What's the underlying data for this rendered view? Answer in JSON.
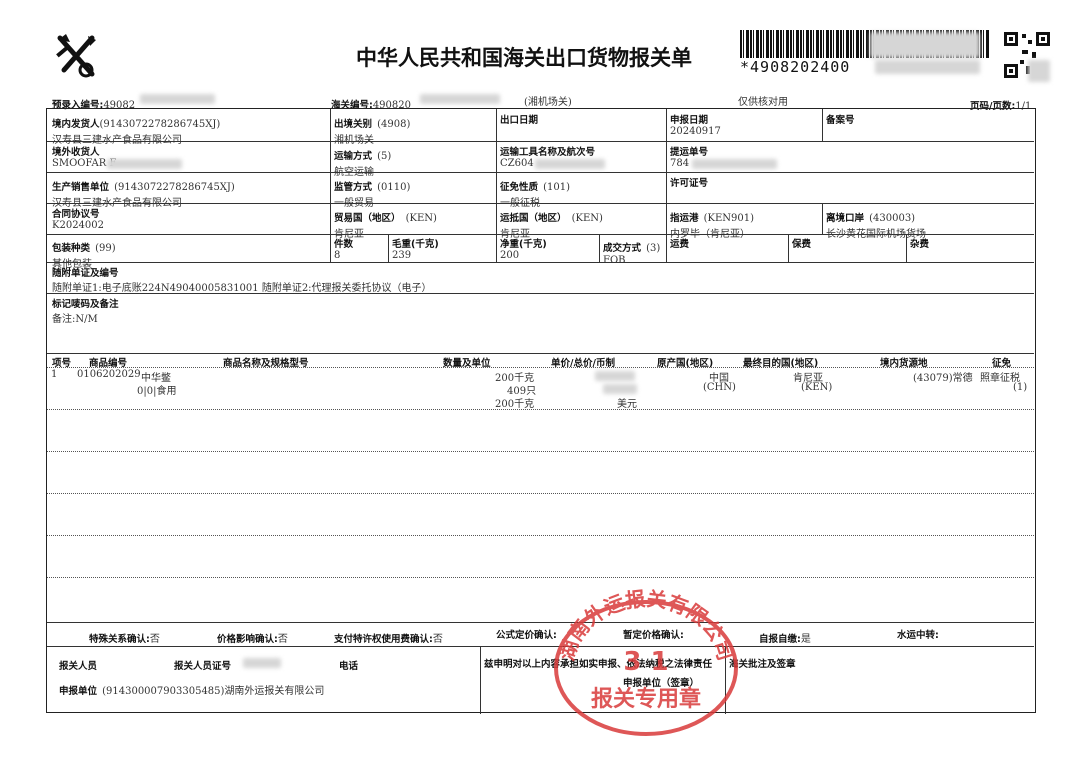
{
  "header": {
    "title": "中华人民共和国海关出口货物报关单",
    "barcode_text": "*4908202400",
    "preentry_label": "预录入编号:",
    "preentry_value": "49082",
    "customs_no_label": "海关编号:",
    "customs_no_value": "490820",
    "customs_office": "(湘机场关)",
    "for_checking": "仅供核对用",
    "page_label": "页码/页数:",
    "page_value": "1/1"
  },
  "fields": {
    "shipper_label": "境内发货人",
    "shipper_code": "(9143072278286745XJ)",
    "shipper_value": "汉寿县三建水产食品有限公司",
    "exit_customs_label": "出境关别",
    "exit_customs_code": "(4908)",
    "exit_customs_value": "湘机场关",
    "exit_date_label": "出口日期",
    "declare_date_label": "申报日期",
    "declare_date_value": "20240917",
    "record_no_label": "备案号",
    "consignee_label": "境外收货人",
    "consignee_value": "SMOOFAR F",
    "transport_mode_label": "运输方式",
    "transport_mode_code": "(5)",
    "transport_mode_value": "航空运输",
    "transport_tool_label": "运输工具名称及航次号",
    "transport_tool_value": "CZ604",
    "bill_no_label": "提运单号",
    "bill_no_value": "784",
    "producer_label": "生产销售单位",
    "producer_code": "(9143072278286745XJ)",
    "producer_value": "汉寿县三建水产食品有限公司",
    "supervision_label": "监管方式",
    "supervision_code": "(0110)",
    "supervision_value": "一般贸易",
    "tax_nature_label": "征免性质",
    "tax_nature_code": "(101)",
    "tax_nature_value": "一般征税",
    "license_label": "许可证号",
    "contract_label": "合同协议号",
    "contract_value": "K2024002",
    "trade_country_label": "贸易国（地区）",
    "trade_country_code": "(KEN)",
    "trade_country_value": "肯尼亚",
    "dest_country_label": "运抵国（地区）",
    "dest_country_code": "(KEN)",
    "dest_country_value": "肯尼亚",
    "dest_port_label": "指运港",
    "dest_port_code": "(KEN901)",
    "dest_port_value": "内罗毕（肯尼亚）",
    "exit_port_label": "离境口岸",
    "exit_port_code": "(430003)",
    "exit_port_value": "长沙黄花国际机场货场",
    "package_label": "包装种类",
    "package_code": "(99)",
    "package_value": "其他包装",
    "pieces_label": "件数",
    "pieces_value": "8",
    "gross_label": "毛重(千克)",
    "gross_value": "239",
    "net_label": "净重(千克)",
    "net_value": "200",
    "deal_label": "成交方式",
    "deal_code": "(3)",
    "deal_value": "FOB",
    "freight_label": "运费",
    "insurance_label": "保费",
    "misc_label": "杂费",
    "docs_label": "随附单证及编号",
    "docs_value": "随附单证1:电子底账224N49040005831001 随附单证2:代理报关委托协议（电子）",
    "marks_label": "标记唛码及备注",
    "marks_value": "备注:N/M"
  },
  "goods": {
    "headers": [
      "项号",
      "商品编号",
      "商品名称及规格型号",
      "数量及单位",
      "单价/总价/币制",
      "原产国(地区)",
      "最终目的国(地区)",
      "境内货源地",
      "征免"
    ],
    "row": {
      "item_no": "1",
      "hs_code": "0106202029",
      "name": "中华鳖",
      "spec": "0|0|食用",
      "qty1": "200千克",
      "qty2": "409只",
      "qty3": "200千克",
      "currency": "美元",
      "origin": "中国",
      "origin_code": "(CHN)",
      "final_dest": "肯尼亚",
      "final_dest_code": "(KEN)",
      "source": "(43079)常德",
      "tax": "照章征税",
      "tax_code": "(1)"
    }
  },
  "footer": {
    "special_label": "特殊关系确认:",
    "special_value": "否",
    "price_label": "价格影响确认:",
    "price_value": "否",
    "royalty_label": "支付特许权使用费确认:",
    "royalty_value": "否",
    "formula_label": "公式定价确认:",
    "provisional_label": "暂定价格确认:",
    "self_report_label": "自报自缴:",
    "self_report_value": "是",
    "waterway_label": "水运中转:",
    "declarant_label": "报关人员",
    "declarant_cert_label": "报关人员证号",
    "phone_label": "电话",
    "statement": "兹申明对以上内容承担如实申报、依法纳税之法律责任",
    "customs_approval_label": "海关批注及签章",
    "unit_label": "申报单位",
    "unit_code": "(914300007903305485)",
    "unit_value": "湖南外运报关有限公司",
    "unit_seal_label": "申报单位（签章）"
  },
  "stamp": {
    "company": "湖南外运报关有限公司",
    "number": "3 1",
    "purpose": "报关专用章",
    "color": "#d93a3a"
  }
}
